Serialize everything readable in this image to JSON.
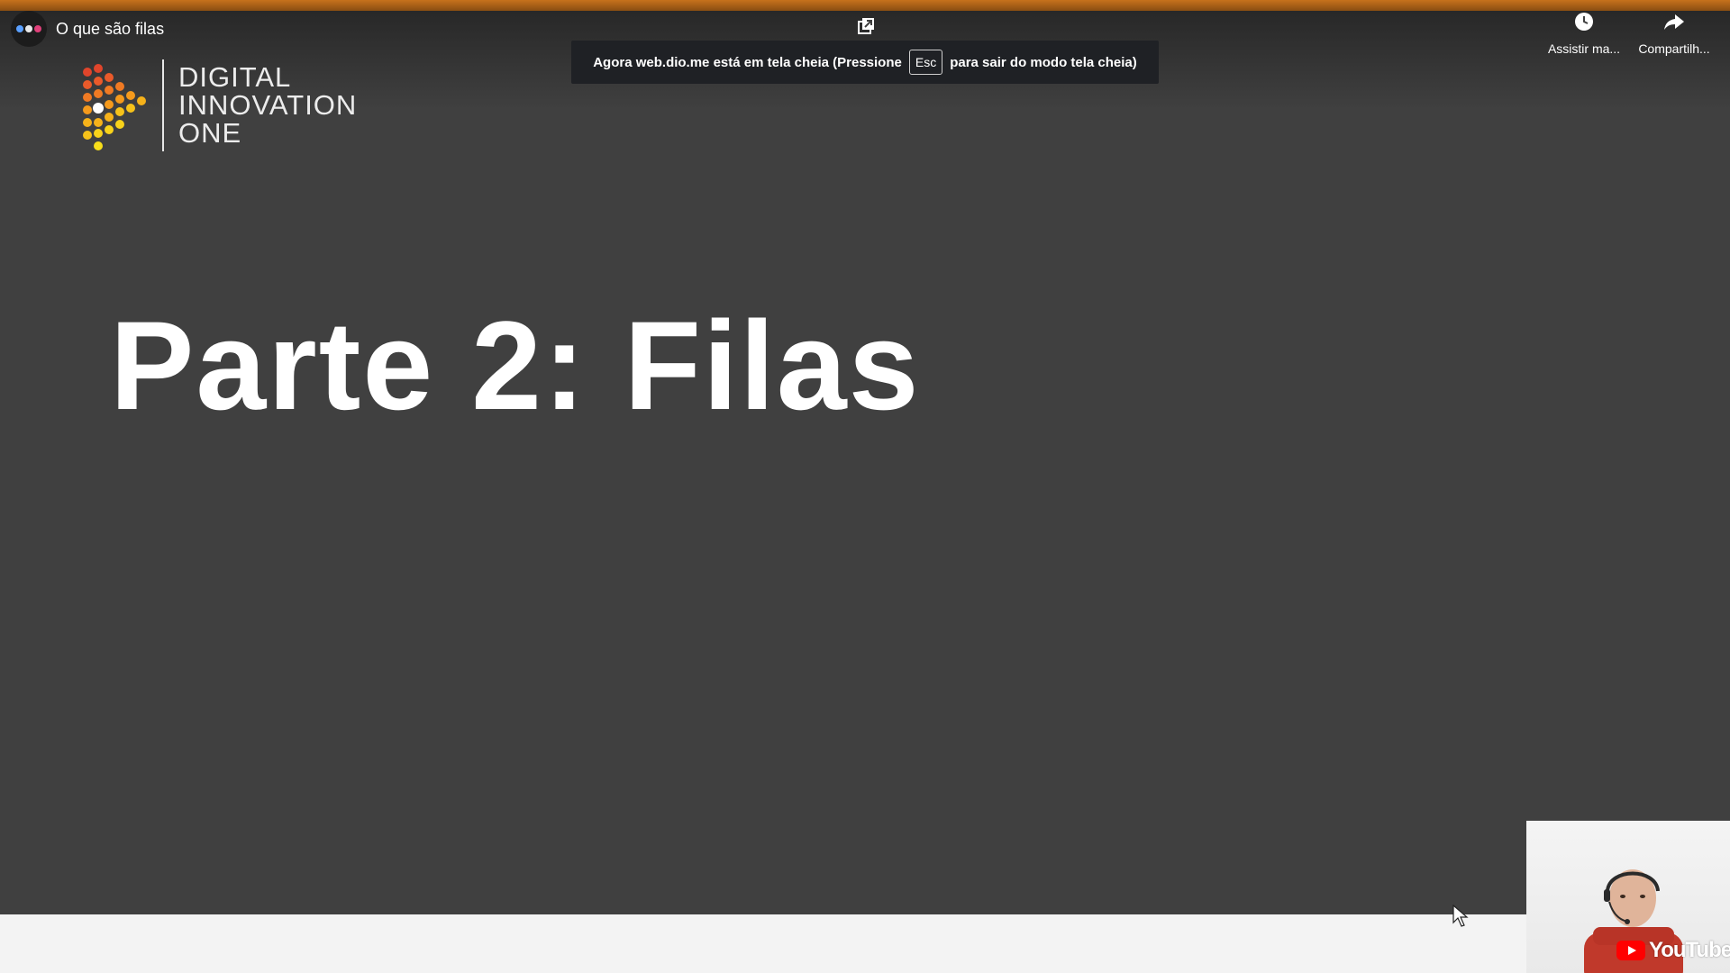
{
  "header": {
    "video_title": "O que são filas",
    "actions": [
      {
        "label": "Assistir ma...",
        "icon": "clock-icon"
      },
      {
        "label": "Compartilh...",
        "icon": "share-icon"
      }
    ]
  },
  "fullscreen_toast": {
    "before": "Agora web.dio.me está em tela cheia (Pressione",
    "key": "Esc",
    "after": "para sair do modo tela cheia)"
  },
  "slide": {
    "logo_lines": [
      "DIGITAL",
      "INNOVATION",
      "ONE"
    ],
    "title": "Parte 2: Filas"
  },
  "webcam": {
    "watermark": "YouTube"
  },
  "colors": {
    "slide_background": "#404040",
    "top_bar": "#c7711c",
    "toast_background": "#1f2125",
    "youtube_red": "#ff0000"
  }
}
